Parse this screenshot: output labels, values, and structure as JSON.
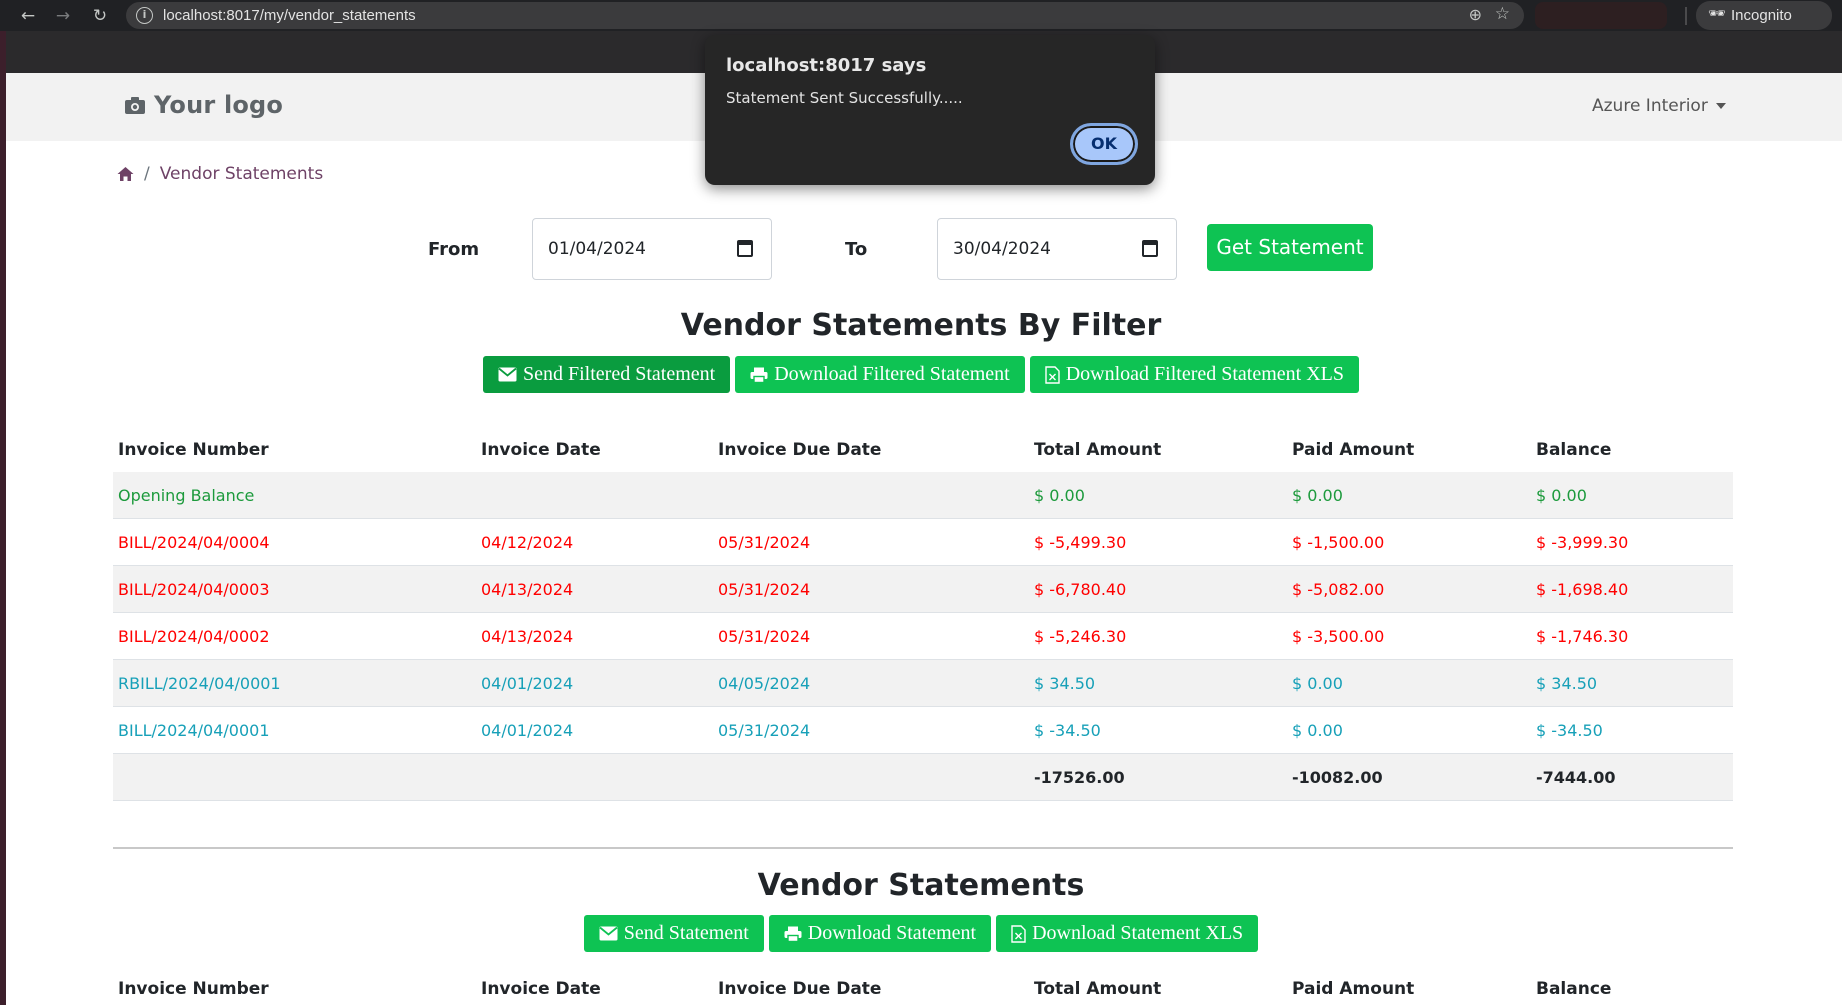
{
  "browser": {
    "url": "localhost:8017/my/vendor_statements",
    "incognito_label": "Incognito"
  },
  "header": {
    "logo_text": "Your logo",
    "company_menu": "Azure Interior"
  },
  "breadcrumb": {
    "current": "Vendor Statements"
  },
  "filter": {
    "from_label": "From",
    "from_value": "01/04/2024",
    "to_label": "To",
    "to_value": "30/04/2024",
    "get_button": "Get Statement"
  },
  "filtered_section": {
    "title": "Vendor Statements By Filter",
    "buttons": [
      "Send Filtered Statement",
      "Download Filtered Statement",
      "Download Filtered Statement XLS"
    ],
    "columns": [
      "Invoice Number",
      "Invoice Date",
      "Invoice Due Date",
      "Total Amount",
      "Paid Amount",
      "Balance"
    ],
    "opening_row": [
      "Opening Balance",
      "",
      "",
      "$ 0.00",
      "$ 0.00",
      "$ 0.00"
    ],
    "rows": [
      [
        "BILL/2024/04/0004",
        "04/12/2024",
        "05/31/2024",
        "$ -5,499.30",
        "$ -1,500.00",
        "$ -3,999.30"
      ],
      [
        "BILL/2024/04/0003",
        "04/13/2024",
        "05/31/2024",
        "$ -6,780.40",
        "$ -5,082.00",
        "$ -1,698.40"
      ],
      [
        "BILL/2024/04/0002",
        "04/13/2024",
        "05/31/2024",
        "$ -5,246.30",
        "$ -3,500.00",
        "$ -1,746.30"
      ],
      [
        "RBILL/2024/04/0001",
        "04/01/2024",
        "04/05/2024",
        "$ 34.50",
        "$ 0.00",
        "$ 34.50"
      ],
      [
        "BILL/2024/04/0001",
        "04/01/2024",
        "05/31/2024",
        "$ -34.50",
        "$ 0.00",
        "$ -34.50"
      ]
    ],
    "totals": [
      "",
      "",
      "",
      "-17526.00",
      "-10082.00",
      "-7444.00"
    ]
  },
  "all_section": {
    "title": "Vendor Statements",
    "buttons": [
      "Send Statement",
      "Download Statement",
      "Download Statement XLS"
    ],
    "columns": [
      "Invoice Number",
      "Invoice Date",
      "Invoice Due Date",
      "Total Amount",
      "Paid Amount",
      "Balance"
    ]
  },
  "dialog": {
    "title": "localhost:8017 says",
    "message": "Statement Sent Successfully.....",
    "ok_label": "OK"
  },
  "colors": {
    "primary_green": "#0ec353",
    "opening_green": "#1c9a3c",
    "negative_red": "#ff0000",
    "positive_teal": "#17a0b8",
    "breadcrumb_purple": "#6e4266"
  }
}
